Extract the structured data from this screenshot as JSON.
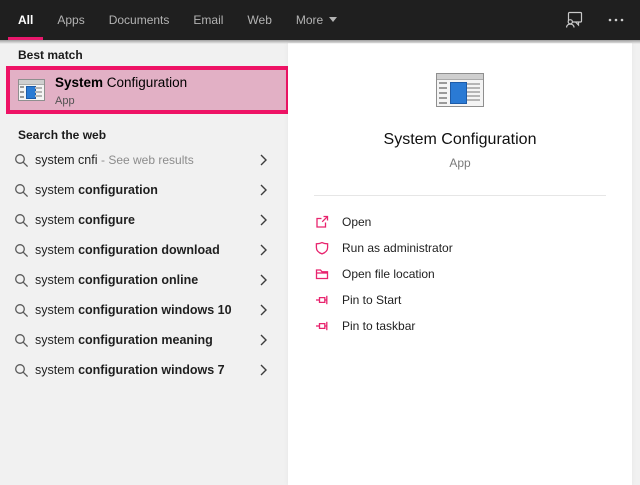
{
  "topbar": {
    "tabs": [
      {
        "label": "All",
        "active": true
      },
      {
        "label": "Apps",
        "active": false
      },
      {
        "label": "Documents",
        "active": false
      },
      {
        "label": "Email",
        "active": false
      },
      {
        "label": "Web",
        "active": false
      },
      {
        "label": "More",
        "active": false
      }
    ]
  },
  "left": {
    "best_match_header": "Best match",
    "best_match": {
      "title_bold": "System",
      "title_rest": " Configuration",
      "subtitle": "App"
    },
    "search_web_header": "Search the web",
    "suggestions": [
      {
        "prefix": "system cnfi ",
        "bold": "",
        "suffix": "- See web results"
      },
      {
        "prefix": "system ",
        "bold": "configuration",
        "suffix": ""
      },
      {
        "prefix": "system ",
        "bold": "configure",
        "suffix": ""
      },
      {
        "prefix": "system ",
        "bold": "configuration download",
        "suffix": ""
      },
      {
        "prefix": "system ",
        "bold": "configuration online",
        "suffix": ""
      },
      {
        "prefix": "system ",
        "bold": "configuration windows 10",
        "suffix": ""
      },
      {
        "prefix": "system ",
        "bold": "configuration meaning",
        "suffix": ""
      },
      {
        "prefix": "system ",
        "bold": "configuration windows 7",
        "suffix": ""
      }
    ]
  },
  "preview": {
    "title": "System Configuration",
    "subtitle": "App",
    "actions": [
      {
        "label": "Open",
        "icon": "open-icon"
      },
      {
        "label": "Run as administrator",
        "icon": "admin-shield-icon"
      },
      {
        "label": "Open file location",
        "icon": "folder-icon"
      },
      {
        "label": "Pin to Start",
        "icon": "pin-icon"
      },
      {
        "label": "Pin to taskbar",
        "icon": "pin-icon"
      }
    ]
  },
  "colors": {
    "topbar_bg": "#1f1f1f",
    "accent_pink": "#e8186c",
    "annotation_border": "#ee1365",
    "best_match_bg": "#e2b0c5",
    "left_panel_bg": "#f1f1f1",
    "card_bg": "#ffffff",
    "app_icon_blue": "#2a7ad4"
  }
}
